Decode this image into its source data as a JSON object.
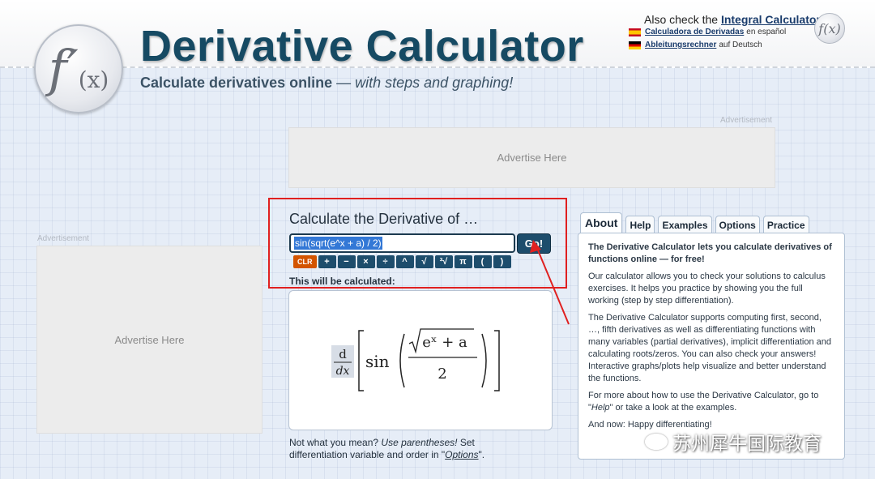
{
  "header": {
    "title": "Derivative Calculator",
    "subtitle_bold": "Calculate derivatives online",
    "subtitle_rest": "— with steps and graphing!",
    "also_check_prefix": "Also check the",
    "also_check_link": "Integral Calculator",
    "also_check_suffix": "!",
    "spanish_link": "Calculadora de Derivadas",
    "spanish_suffix": "en español",
    "german_link": "Ableitungsrechner",
    "german_suffix": "auf Deutsch",
    "logo_f": "f′",
    "logo_x": "(x)",
    "small_logo": "f(x)"
  },
  "ads": {
    "top_label": "Advertisement",
    "top_text": "Advertise Here",
    "left_label": "Advertisement",
    "left_text": "Advertise Here"
  },
  "calculator": {
    "heading": "Calculate the Derivative of …",
    "input_value": "sin(sqrt(e^x + a) / 2)",
    "go_label": "Go!",
    "keys": [
      "CLR",
      "+",
      "−",
      "×",
      "÷",
      "^",
      "√",
      "³√",
      "π",
      "(",
      ")"
    ],
    "preview_label": "This will be calculated:",
    "preview_d": "d",
    "preview_dx": "dx",
    "preview_sin": "sin",
    "preview_num": "eˣ + a",
    "preview_den": "2",
    "hint_1": "Not what you mean?",
    "hint_2": "Use parentheses!",
    "hint_3": "Set differentiation variable and order in \"",
    "hint_link": "Options",
    "hint_4": "\"."
  },
  "tabs": [
    "About",
    "Help",
    "Examples",
    "Options",
    "Practice"
  ],
  "about": {
    "lead": "The Derivative Calculator lets you calculate derivatives of functions online — for free!",
    "p1": "Our calculator allows you to check your solutions to calculus exercises. It helps you practice by showing you the full working (step by step differentiation).",
    "p2": "The Derivative Calculator supports computing first, second, …, fifth derivatives as well as differentiating functions with many variables (partial derivatives), implicit differentiation and calculating roots/zeros. You can also check your answers! Interactive graphs/plots help visualize and better understand the functions.",
    "p3_a": "For more about how to use the Derivative Calculator, go to \"",
    "p3_help": "Help",
    "p3_b": "\" or take a look at the examples.",
    "p4": "And now: Happy differentiating!"
  },
  "watermark": "苏州犀牛国际教育",
  "colors": {
    "brand": "#164a63",
    "button": "#1d4d6c",
    "clear_button": "#d35400",
    "annotation": "#e02020",
    "selection": "#3378d6"
  }
}
